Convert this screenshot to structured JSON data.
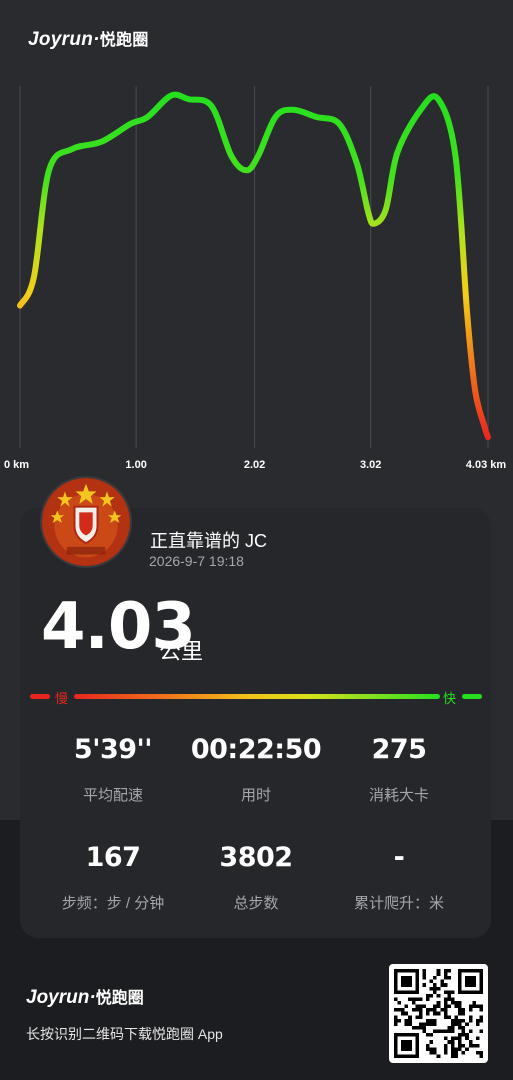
{
  "brand": {
    "logo_latin": "Joyrun",
    "logo_dot": "·",
    "logo_cn": "悦跑圈"
  },
  "chart_data": {
    "type": "line",
    "title": "",
    "xlabel": "",
    "ylabel": "",
    "x_ticks": [
      "0 km",
      "1.00",
      "2.02",
      "3.02",
      "4.03 km"
    ],
    "x_tick_values": [
      0,
      1.0,
      2.02,
      3.02,
      4.03
    ],
    "xlim": [
      0,
      4.03
    ],
    "ylim": [
      0,
      100
    ],
    "grid": "vertical",
    "series": [
      {
        "x": [
          0,
          0.12,
          0.25,
          0.45,
          0.7,
          0.95,
          1.1,
          1.3,
          1.45,
          1.65,
          1.82,
          1.95,
          2.05,
          2.2,
          2.35,
          2.55,
          2.75,
          2.9,
          3.0,
          3.05,
          3.15,
          3.25,
          3.45,
          3.6,
          3.75,
          3.85,
          3.92,
          4.0,
          4.03
        ],
        "y": [
          40,
          48,
          78,
          84,
          86,
          91,
          93,
          99,
          98,
          96,
          82,
          78,
          82,
          93,
          95,
          93,
          91,
          80,
          66,
          63,
          67,
          83,
          95,
          98,
          82,
          38,
          16,
          6,
          3
        ]
      }
    ]
  },
  "summary": {
    "user_name": "正直靠谱的 JC",
    "datetime": "2026-9-7 19:18",
    "distance": "4.03",
    "distance_unit": "公里"
  },
  "pace_legend": {
    "slow_label": "慢",
    "fast_label": "快"
  },
  "stats": [
    {
      "value": "5'39''",
      "label": "平均配速"
    },
    {
      "value": "00:22:50",
      "label": "用时"
    },
    {
      "value": "275",
      "label": "消耗大卡"
    },
    {
      "value": "167",
      "label": "步频：步 / 分钟"
    },
    {
      "value": "3802",
      "label": "总步数"
    },
    {
      "value": "-",
      "label": "累计爬升：米"
    }
  ],
  "footer": {
    "logo_latin": "Joyrun",
    "logo_dot": "·",
    "logo_cn": "悦跑圈",
    "download_text": "长按识别二维码下载悦跑圈 App"
  },
  "icons": {
    "avatar": "avatar-badge-icon",
    "qr": "qr-code-icon"
  },
  "colors": {
    "background": "#2a2b2f",
    "card": "#25272b",
    "slow": "#e8261f",
    "fast": "#26e020"
  }
}
